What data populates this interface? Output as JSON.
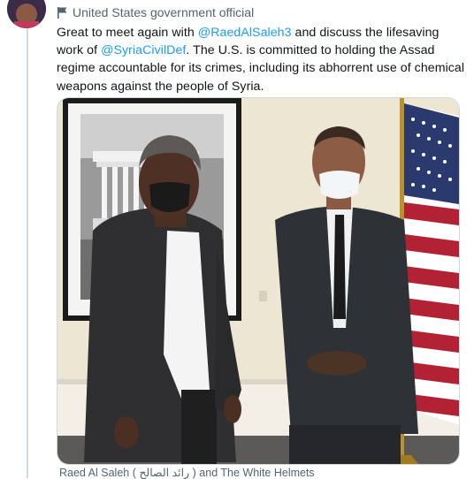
{
  "account_label": {
    "icon": "flag-icon",
    "text": "United States government official"
  },
  "tweet": {
    "part1": "Great to meet again with ",
    "mention1": "@RaedAlSaleh3",
    "part2": " and discuss the lifesaving work of ",
    "mention2": "@SyriaCivilDef",
    "part3": ". The U.S. is committed to holding the Assad regime accountable for its crimes, including its abhorrent use of chemical weapons against the people of Syria."
  },
  "media": {
    "tags_text": "Raed Al Saleh ( رائد الصالح ) and The White Helmets"
  },
  "colors": {
    "link": "#1d9bf0",
    "secondary_text": "#536471",
    "primary_text": "#0f1419",
    "border": "#cfd9de"
  }
}
